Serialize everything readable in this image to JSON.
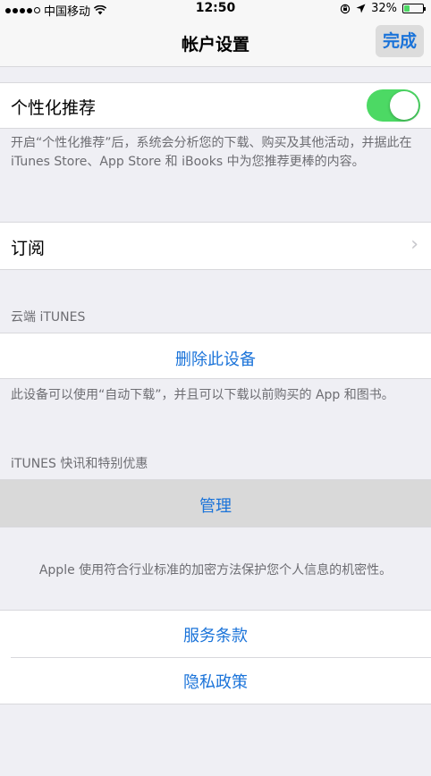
{
  "status_bar": {
    "carrier": "中国移动",
    "time": "12:50",
    "battery_percent": "32%",
    "battery_level": 0.32,
    "accent_battery": "#4cd964"
  },
  "nav": {
    "title": "帐户设置",
    "done_label": "完成"
  },
  "personalization": {
    "label": "个性化推荐",
    "toggle_on": true,
    "description": "开启“个性化推荐”后，系统会分析您的下载、购买及其他活动，并据此在 iTunes Store、App Store 和 iBooks 中为您推荐更棒的内容。"
  },
  "subscriptions": {
    "label": "订阅"
  },
  "cloud_itunes": {
    "header": "云端 iTUNES",
    "remove_device_label": "删除此设备",
    "description": "此设备可以使用“自动下载”，并且可以下载以前购买的 App 和图书。"
  },
  "newsletters": {
    "header": "iTUNES 快讯和特别优惠",
    "manage_label": "管理"
  },
  "privacy": {
    "note": "Apple 使用符合行业标准的加密方法保护您个人信息的机密性。",
    "terms_label": "服务条款",
    "privacy_policy_label": "隐私政策"
  },
  "colors": {
    "link": "#1a73d9",
    "toggle_on": "#4cd964",
    "background": "#efeff4"
  }
}
